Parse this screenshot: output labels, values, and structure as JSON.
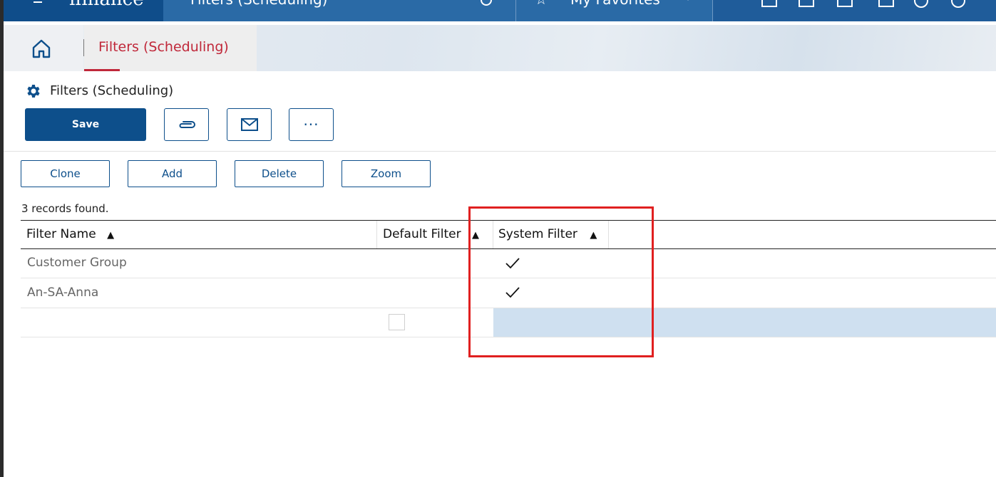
{
  "topbar": {
    "logo": "ifinance",
    "title": "Filters (Scheduling)",
    "favorites": "My Favorites"
  },
  "tabbar": {
    "tab_label": "Filters (Scheduling)"
  },
  "page": {
    "title": "Filters (Scheduling)"
  },
  "toolbar": {
    "save_label": "Save",
    "more_label": "···"
  },
  "actions": {
    "clone": "Clone",
    "add": "Add",
    "delete": "Delete",
    "zoom": "Zoom"
  },
  "grid": {
    "records_text": "3 records found.",
    "columns": [
      {
        "label": "Filter Name",
        "sort": "▲"
      },
      {
        "label": "Default Filter",
        "sort": "▲"
      },
      {
        "label": "System Filter",
        "sort": "▲"
      }
    ],
    "rows": [
      {
        "filter_name": "Customer Group",
        "default_filter": false,
        "system_filter": true
      },
      {
        "filter_name": "An-SA-Anna",
        "default_filter": false,
        "system_filter": true
      },
      {
        "filter_name": "",
        "default_filter": false,
        "system_filter": false
      }
    ]
  }
}
